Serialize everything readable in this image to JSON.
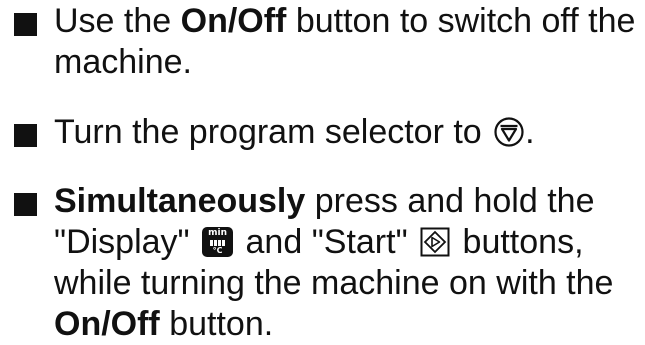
{
  "steps": [
    {
      "prefix": "Use the ",
      "bold": "On/Off",
      "suffix": " button to switch off the machine."
    },
    {
      "prefix": "Turn the program selector to ",
      "symbol_icon": "program-selector-position-symbol",
      "suffix": "."
    },
    {
      "bold_lead": "Simultaneously",
      "text_a": " press and hold the \"Display\" ",
      "display_icon": {
        "name": "display-button-icon",
        "top": "min",
        "bottom": "°C"
      },
      "text_b": " and \"Start\" ",
      "start_icon": "start-button-icon",
      "text_c": " buttons, while turning the machine on with the ",
      "bold_tail": "On/Off",
      "text_d": " button."
    }
  ]
}
